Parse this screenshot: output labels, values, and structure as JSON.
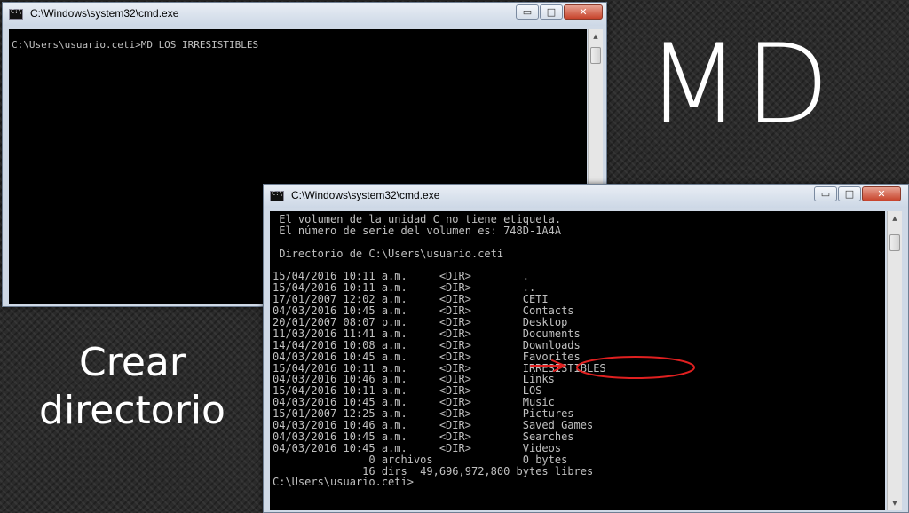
{
  "heading": "MD",
  "subtitle_lines": [
    "Crear",
    "directorio"
  ],
  "window1": {
    "title": "C:\\Windows\\system32\\cmd.exe",
    "controls": {
      "minimize": "▭",
      "maximize": "□",
      "close": "✕"
    },
    "lines": [
      "C:\\Users\\usuario.ceti>MD LOS IRRESISTIBLES"
    ]
  },
  "window2": {
    "title": "C:\\Windows\\system32\\cmd.exe",
    "controls": {
      "minimize": "▭",
      "maximize": "□",
      "close": "✕"
    },
    "header_lines": [
      " El volumen de la unidad C no tiene etiqueta.",
      " El número de serie del volumen es: 748D-1A4A",
      "",
      " Directorio de C:\\Users\\usuario.ceti",
      ""
    ],
    "entries": [
      {
        "date": "15/04/2016",
        "time": "10:11",
        "ampm": "a.m.",
        "type": "<DIR>",
        "name": "."
      },
      {
        "date": "15/04/2016",
        "time": "10:11",
        "ampm": "a.m.",
        "type": "<DIR>",
        "name": ".."
      },
      {
        "date": "17/01/2007",
        "time": "12:02",
        "ampm": "a.m.",
        "type": "<DIR>",
        "name": "CETI"
      },
      {
        "date": "04/03/2016",
        "time": "10:45",
        "ampm": "a.m.",
        "type": "<DIR>",
        "name": "Contacts"
      },
      {
        "date": "20/01/2007",
        "time": "08:07",
        "ampm": "p.m.",
        "type": "<DIR>",
        "name": "Desktop"
      },
      {
        "date": "11/03/2016",
        "time": "11:41",
        "ampm": "a.m.",
        "type": "<DIR>",
        "name": "Documents"
      },
      {
        "date": "14/04/2016",
        "time": "10:08",
        "ampm": "a.m.",
        "type": "<DIR>",
        "name": "Downloads"
      },
      {
        "date": "04/03/2016",
        "time": "10:45",
        "ampm": "a.m.",
        "type": "<DIR>",
        "name": "Favorites"
      },
      {
        "date": "15/04/2016",
        "time": "10:11",
        "ampm": "a.m.",
        "type": "<DIR>",
        "name": "IRRESISTIBLES"
      },
      {
        "date": "04/03/2016",
        "time": "10:46",
        "ampm": "a.m.",
        "type": "<DIR>",
        "name": "Links"
      },
      {
        "date": "15/04/2016",
        "time": "10:11",
        "ampm": "a.m.",
        "type": "<DIR>",
        "name": "LOS"
      },
      {
        "date": "04/03/2016",
        "time": "10:45",
        "ampm": "a.m.",
        "type": "<DIR>",
        "name": "Music"
      },
      {
        "date": "15/01/2007",
        "time": "12:25",
        "ampm": "a.m.",
        "type": "<DIR>",
        "name": "Pictures"
      },
      {
        "date": "04/03/2016",
        "time": "10:46",
        "ampm": "a.m.",
        "type": "<DIR>",
        "name": "Saved Games"
      },
      {
        "date": "04/03/2016",
        "time": "10:45",
        "ampm": "a.m.",
        "type": "<DIR>",
        "name": "Searches"
      },
      {
        "date": "04/03/2016",
        "time": "10:45",
        "ampm": "a.m.",
        "type": "<DIR>",
        "name": "Videos"
      }
    ],
    "summary_lines": [
      "               0 archivos              0 bytes",
      "              16 dirs  49,696,972,800 bytes libres"
    ],
    "prompt": "C:\\Users\\usuario.ceti>"
  },
  "annotation": {
    "color": "#e02020",
    "highlighted_entry": "IRRESISTIBLES"
  }
}
